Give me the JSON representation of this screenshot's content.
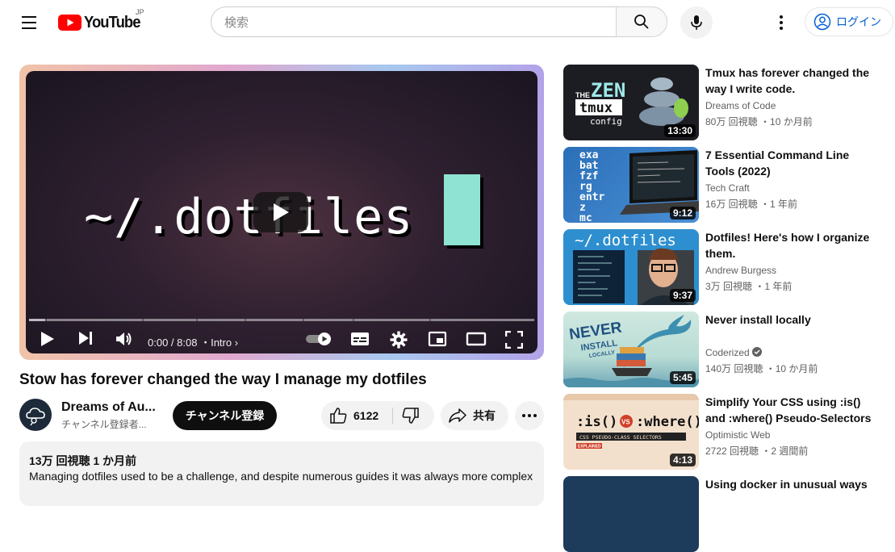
{
  "header": {
    "logo_text": "YouTube",
    "region": "JP",
    "search_placeholder": "検索",
    "login_label": "ログイン"
  },
  "player": {
    "overlay_text": "~/.dotfiles",
    "time": "0:00 / 8:08",
    "chapter": "・Intro",
    "progress": 0.0
  },
  "video": {
    "title": "Stow has forever changed the way I manage my dotfiles",
    "channel_name": "Dreams of Au...",
    "channel_subs": "チャンネル登録者...",
    "subscribe_label": "チャンネル登録",
    "likes": "6122",
    "share_label": "共有",
    "stats": "13万 回視聴  1 か月前",
    "description": "Managing dotfiles used to be a challenge, and despite numerous guides it was always more complex"
  },
  "related": [
    {
      "title": "Tmux has forever changed the way I write code.",
      "channel": "Dreams of Code",
      "meta": "80万 回視聴 ・10 か月前",
      "duration": "13:30",
      "verified": false,
      "thumb": "zen-tmux"
    },
    {
      "title": "7 Essential Command Line Tools (2022)",
      "channel": "Tech Craft",
      "meta": "16万 回視聴 ・1 年前",
      "duration": "9:12",
      "verified": false,
      "thumb": "cli-tools"
    },
    {
      "title": "Dotfiles! Here's how I organize them.",
      "channel": "Andrew Burgess",
      "meta": "3万 回視聴 ・1 年前",
      "duration": "9:37",
      "verified": false,
      "thumb": "dotfiles"
    },
    {
      "title": "Never install locally",
      "channel": "Coderized",
      "meta": "140万 回視聴 ・10 か月前",
      "duration": "5:45",
      "verified": true,
      "thumb": "never-install"
    },
    {
      "title": "Simplify Your CSS using :is() and :where() Pseudo-Selectors",
      "channel": "Optimistic Web",
      "meta": "2722 回視聴 ・2 週間前",
      "duration": "4:13",
      "verified": false,
      "thumb": "css-is-where"
    },
    {
      "title": "Using docker in unusual ways",
      "channel": "",
      "meta": "",
      "duration": "",
      "verified": false,
      "thumb": "docker"
    }
  ],
  "thumb_text": {
    "zen_a": "THE",
    "zen_b": "ZEN",
    "zen_c": "tmux",
    "zen_d": "config",
    "cli_words": "exa bat fzf rg entr z mc",
    "dot": "~/.dotfiles",
    "never_a": "NEVER",
    "never_b": "INSTALL",
    "never_c": "LOCALLY",
    "css_a": ":is()",
    "css_vs": "VS",
    "css_b": ":where()",
    "css_sub": "CSS PSEUDO-CLASS SELECTORS",
    "css_tag": "EXPLAINED"
  },
  "colors": {
    "brand_red": "#ff0000",
    "link_blue": "#065fd4",
    "cursor_teal": "#8fe3d3"
  }
}
